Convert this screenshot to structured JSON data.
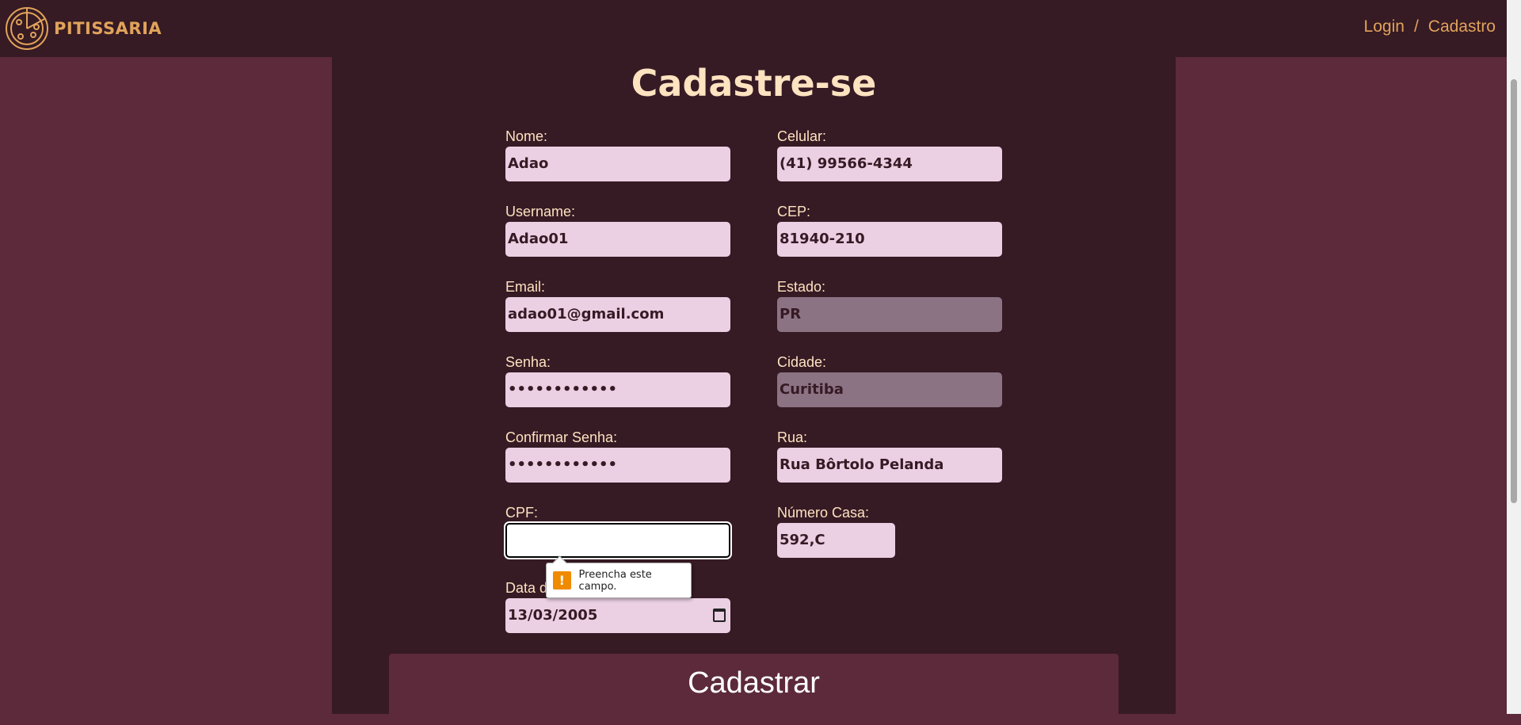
{
  "header": {
    "brand": "PITISSARIA",
    "nav": {
      "login": "Login",
      "separator": "/",
      "cadastro": "Cadastro"
    }
  },
  "form": {
    "title": "Cadastre-se",
    "left": [
      {
        "label": "Nome:",
        "value": "Adao"
      },
      {
        "label": "Username:",
        "value": "Adao01"
      },
      {
        "label": "Email:",
        "value": "adao01@gmail.com"
      },
      {
        "label": "Senha:",
        "value": "••••••••••••"
      },
      {
        "label": "Confirmar Senha:",
        "value": "••••••••••••"
      },
      {
        "label": "CPF:",
        "value": ""
      },
      {
        "label": "Data de Nascimento:",
        "value": "13/03/2005"
      }
    ],
    "right": [
      {
        "label": "Celular:",
        "value": "(41) 99566-4344"
      },
      {
        "label": "CEP:",
        "value": "81940-210"
      },
      {
        "label": "Estado:",
        "value": "PR"
      },
      {
        "label": "Cidade:",
        "value": "Curitiba"
      },
      {
        "label": "Rua:",
        "value": "Rua Bôrtolo Pelanda"
      },
      {
        "label": "Número Casa:",
        "value": "592,C"
      }
    ],
    "tooltip": "Preencha este campo.",
    "submit": "Cadastrar"
  }
}
